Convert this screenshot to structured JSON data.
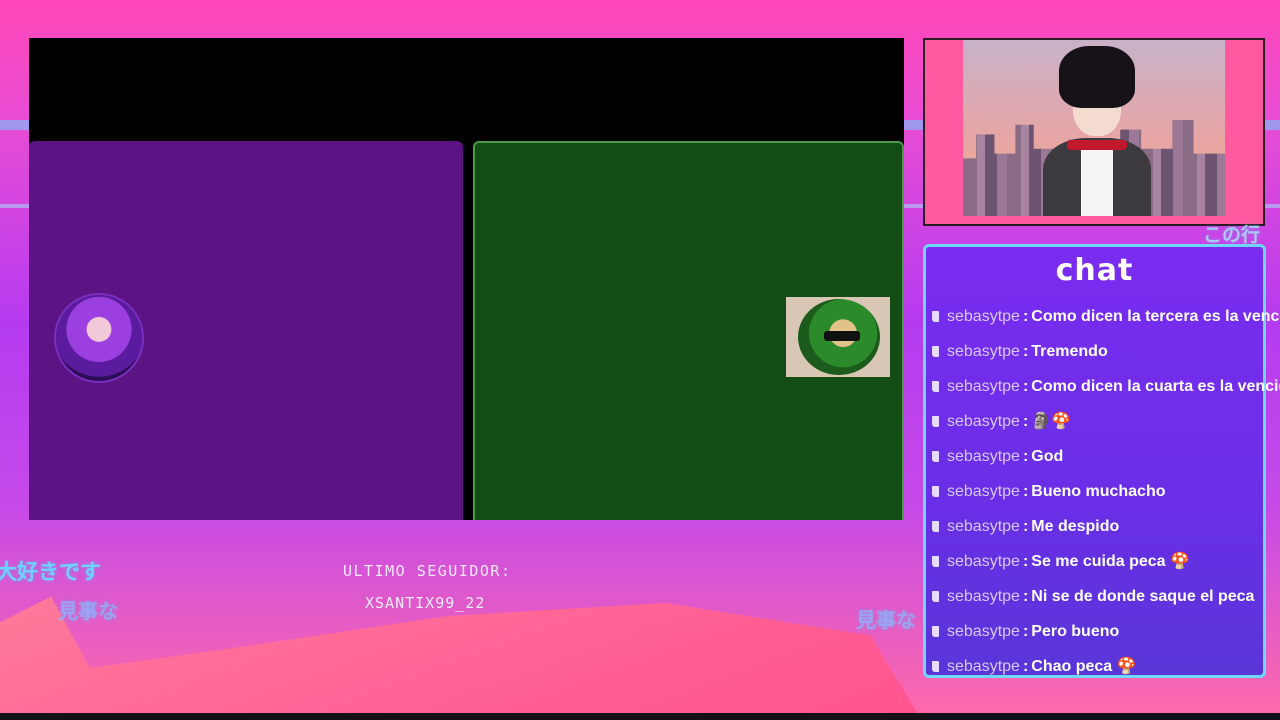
{
  "decorations": {
    "japanese_1": "大好きです",
    "japanese_2": "見事な",
    "japanese_3": "見事な",
    "japanese_4": "この行"
  },
  "follower": {
    "label": "ULTIMO SEGUIDOR:",
    "name": "XSANTIX99_22"
  },
  "chat": {
    "title": "chat",
    "messages": [
      {
        "user": "sebasytpe",
        "text": "Como dicen la tercera es la vencida"
      },
      {
        "user": "sebasytpe",
        "text": "Tremendo"
      },
      {
        "user": "sebasytpe",
        "text": "Como dicen la cuarta es la vencida"
      },
      {
        "user": "sebasytpe",
        "text": "🗿🍄"
      },
      {
        "user": "sebasytpe",
        "text": "God"
      },
      {
        "user": "sebasytpe",
        "text": "Bueno muchacho"
      },
      {
        "user": "sebasytpe",
        "text": "Me despido"
      },
      {
        "user": "sebasytpe",
        "text": "Se me cuida peca 🍄"
      },
      {
        "user": "sebasytpe",
        "text": "Ni se de donde saque el peca"
      },
      {
        "user": "sebasytpe",
        "text": "Pero bueno"
      },
      {
        "user": "sebasytpe",
        "text": "Chao peca 🍄"
      }
    ]
  },
  "colors": {
    "chat_border": "#6fd6ff",
    "panel_purple": "#5c1384",
    "panel_green": "#134d15"
  }
}
